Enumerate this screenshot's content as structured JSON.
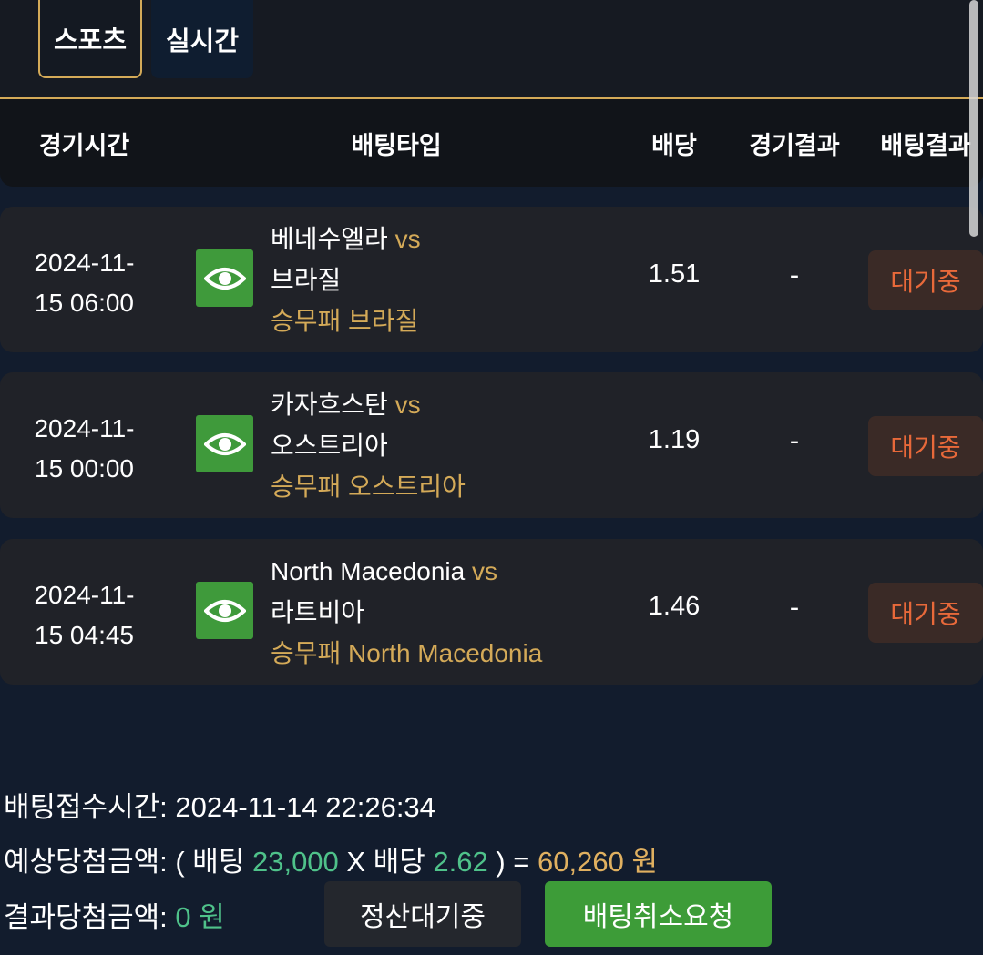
{
  "tabs": [
    {
      "label": "스포츠",
      "active": true
    },
    {
      "label": "실시간",
      "active": false
    }
  ],
  "header": {
    "time": "경기시간",
    "type": "배팅타입",
    "odds": "배당",
    "game_result": "경기결과",
    "bet_result": "배팅결과"
  },
  "rows": [
    {
      "time_line1": "2024-11-",
      "time_line2": "15 06:00",
      "home": "베네수엘라",
      "vs": "vs",
      "away": "브라질",
      "pick": "승무패 브라질",
      "odds": "1.51",
      "result": "-",
      "status": "대기중"
    },
    {
      "time_line1": "2024-11-",
      "time_line2": "15 00:00",
      "home": "카자흐스탄",
      "vs": "vs",
      "away": "오스트리아",
      "pick": "승무패 오스트리아",
      "odds": "1.19",
      "result": "-",
      "status": "대기중"
    },
    {
      "time_line1": "2024-11-",
      "time_line2": "15 04:45",
      "home": "North Macedonia",
      "vs": "vs",
      "away": "라트비아",
      "pick": "승무패 North Macedonia",
      "odds": "1.46",
      "result": "-",
      "status": "대기중"
    }
  ],
  "summary": {
    "bet_time_label": "배팅접수시간:",
    "bet_time": "2024-11-14 22:26:34",
    "expected_label": "예상당첨금액:",
    "open_paren": "( 배팅",
    "stake": "23,000",
    "x_odds": "X 배당",
    "total_odds": "2.62",
    "close_eq": ") =",
    "expected_amount": "60,260 원",
    "result_label": "결과당첨금액:",
    "result_amount": "0 원"
  },
  "buttons": {
    "settle_wait": "정산대기중",
    "cancel_request": "배팅취소요청"
  },
  "colors": {
    "accent_gold": "#d4aa58",
    "status_orange": "#e8693a",
    "green_button": "#3d9c38",
    "green_text": "#4fc28a"
  }
}
